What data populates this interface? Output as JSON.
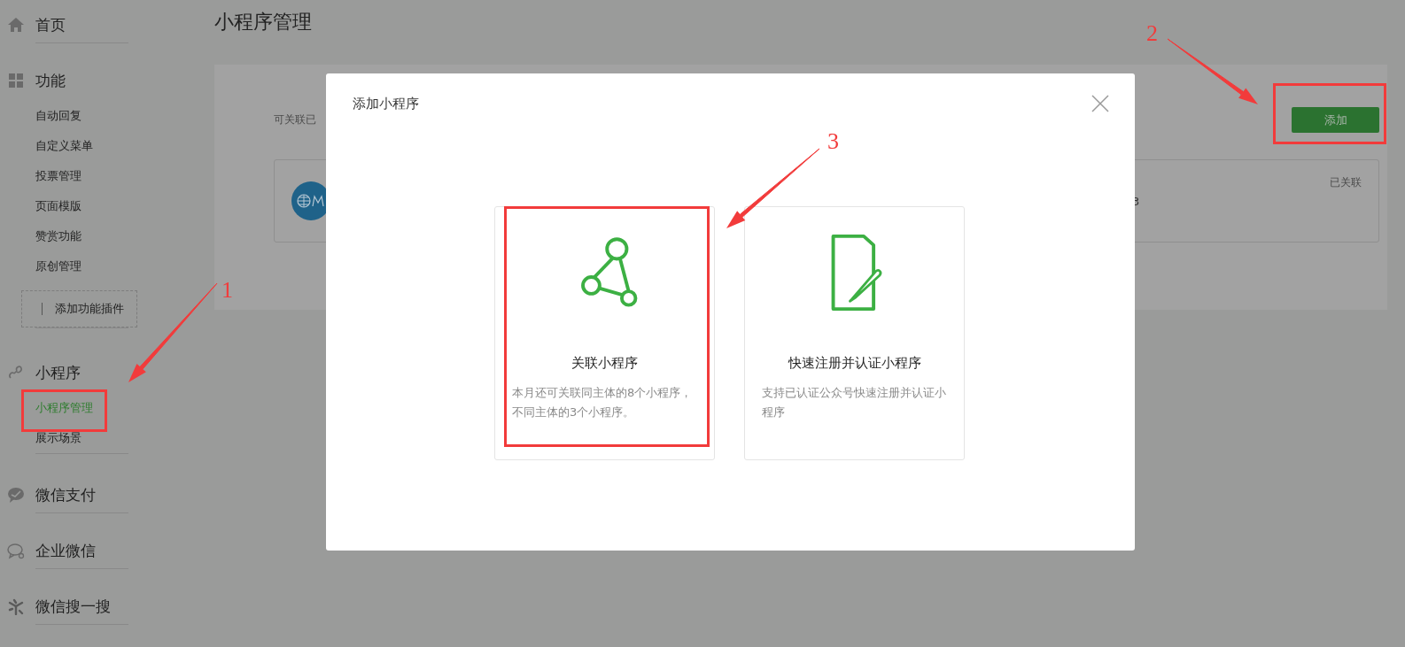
{
  "sidebar": {
    "sections": [
      {
        "label": "首页"
      },
      {
        "label": "功能",
        "items": [
          {
            "label": "自动回复",
            "selected": false
          },
          {
            "label": "自定义菜单",
            "selected": false
          },
          {
            "label": "投票管理",
            "selected": false
          },
          {
            "label": "页面模版",
            "selected": false
          },
          {
            "label": "赞赏功能",
            "selected": false
          },
          {
            "label": "原创管理",
            "selected": false
          }
        ],
        "plugin_button": "添加功能插件"
      },
      {
        "label": "小程序",
        "items": [
          {
            "label": "小程序管理",
            "selected": true
          },
          {
            "label": "展示场景",
            "selected": false
          }
        ]
      },
      {
        "label": "微信支付"
      },
      {
        "label": "企业微信"
      },
      {
        "label": "微信搜一搜"
      }
    ]
  },
  "main": {
    "title": "小程序管理",
    "panel": {
      "note": "可关联已",
      "add_button": "添加",
      "card": {
        "text_fragment": "3",
        "status": "已关联"
      }
    }
  },
  "dialog": {
    "title": "添加小程序",
    "options": [
      {
        "title": "关联小程序",
        "description": "本月还可关联同主体的8个小程序，不同主体的3个小程序。"
      },
      {
        "title": "快速注册并认证小程序",
        "description": "支持已认证公众号快速注册并认证小程序"
      }
    ]
  },
  "annotations": [
    {
      "label": "1"
    },
    {
      "label": "2"
    },
    {
      "label": "3"
    }
  ]
}
